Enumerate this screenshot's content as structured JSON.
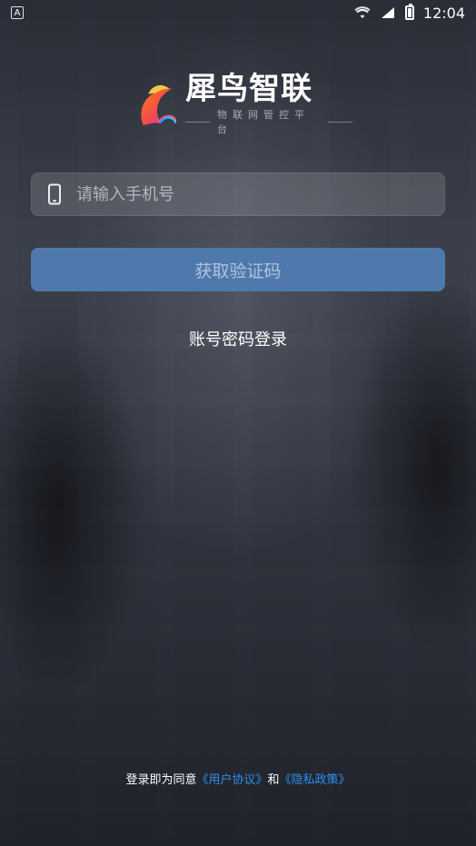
{
  "status_bar": {
    "left_badge": "A",
    "time": "12:04",
    "icons": [
      "wifi-icon",
      "signal-icon",
      "battery-icon"
    ]
  },
  "brand": {
    "name": "犀鸟智联",
    "tagline": "物联网管控平台"
  },
  "login": {
    "phone_placeholder": "请输入手机号",
    "phone_value": "",
    "get_code_label": "获取验证码",
    "account_password_login_label": "账号密码登录"
  },
  "agreement": {
    "prefix": "登录即为同意",
    "user_agreement": "《用户协议》",
    "and": "和",
    "privacy_policy": "《隐私政策》"
  },
  "colors": {
    "primary_button": "#4f79ad",
    "link": "#2f8ff3",
    "text": "#ffffff",
    "muted_text": "rgba(255,255,255,0.55)"
  }
}
